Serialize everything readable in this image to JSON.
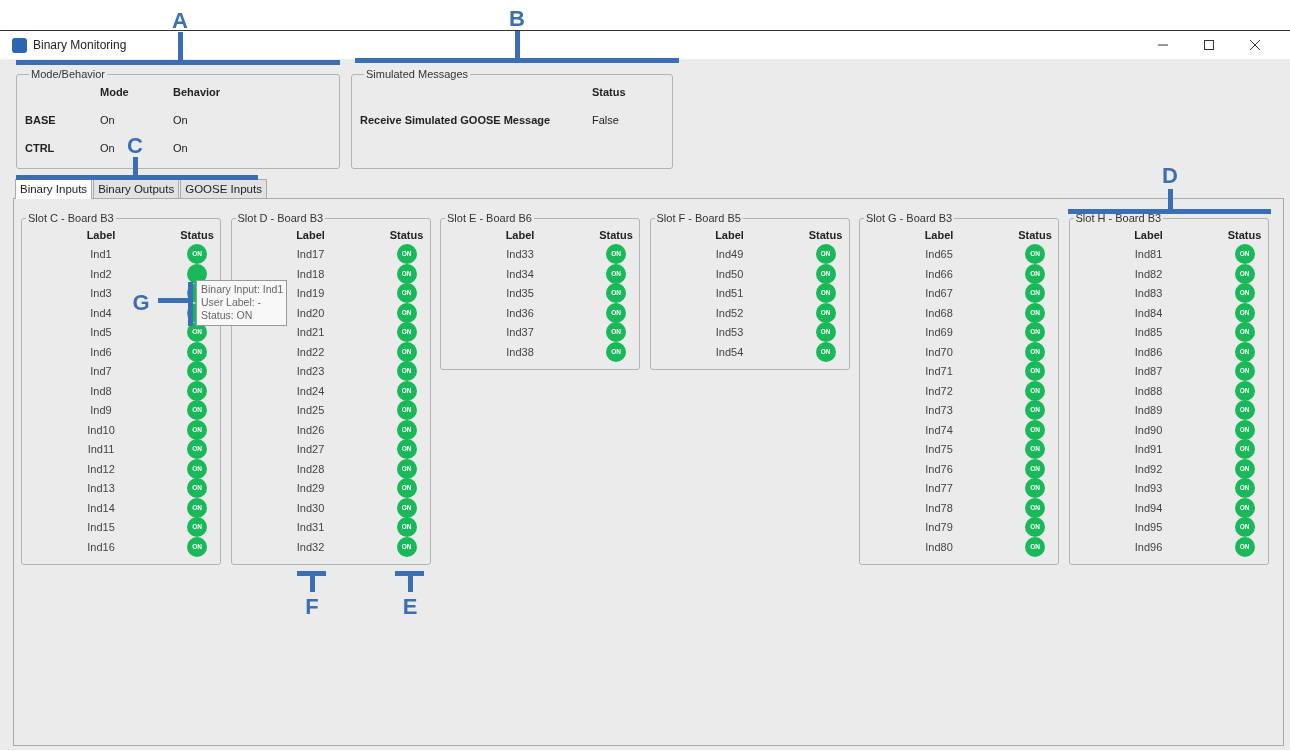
{
  "window": {
    "title": "Binary Monitoring"
  },
  "mode_behavior": {
    "title": "Mode/Behavior",
    "columns": [
      "Mode",
      "Behavior"
    ],
    "rows": [
      {
        "name": "BASE",
        "mode": "On",
        "behavior": "On"
      },
      {
        "name": "CTRL",
        "mode": "On",
        "behavior": "On"
      }
    ]
  },
  "simulated_messages": {
    "title": "Simulated Messages",
    "columns": [
      "Status"
    ],
    "rows": [
      {
        "name": "Receive Simulated GOOSE Message",
        "status": "False"
      }
    ]
  },
  "tabs": [
    {
      "label": "Binary Inputs",
      "selected": true
    },
    {
      "label": "Binary Outputs",
      "selected": false
    },
    {
      "label": "GOOSE Inputs",
      "selected": false
    }
  ],
  "slots": [
    {
      "title": "Slot C - Board B3",
      "columns": [
        "Label",
        "Status"
      ],
      "rows": [
        {
          "label": "Ind1",
          "status": "ON"
        },
        {
          "label": "Ind2"
        },
        {
          "label": "Ind3"
        },
        {
          "label": "Ind4"
        },
        {
          "label": "Ind5",
          "status": "ON"
        },
        {
          "label": "Ind6",
          "status": "ON"
        },
        {
          "label": "Ind7",
          "status": "ON"
        },
        {
          "label": "Ind8",
          "status": "ON"
        },
        {
          "label": "Ind9",
          "status": "ON"
        },
        {
          "label": "Ind10",
          "status": "ON"
        },
        {
          "label": "Ind11",
          "status": "ON"
        },
        {
          "label": "Ind12",
          "status": "ON"
        },
        {
          "label": "Ind13",
          "status": "ON"
        },
        {
          "label": "Ind14",
          "status": "ON"
        },
        {
          "label": "Ind15",
          "status": "ON"
        },
        {
          "label": "Ind16",
          "status": "ON"
        }
      ]
    },
    {
      "title": "Slot D - Board B3",
      "columns": [
        "Label",
        "Status"
      ],
      "rows": [
        {
          "label": "Ind17",
          "status": "ON"
        },
        {
          "label": "Ind18",
          "status": "ON"
        },
        {
          "label": "Ind19",
          "status": "ON"
        },
        {
          "label": "Ind20",
          "status": "ON"
        },
        {
          "label": "Ind21",
          "status": "ON"
        },
        {
          "label": "Ind22",
          "status": "ON"
        },
        {
          "label": "Ind23",
          "status": "ON"
        },
        {
          "label": "Ind24",
          "status": "ON"
        },
        {
          "label": "Ind25",
          "status": "ON"
        },
        {
          "label": "Ind26",
          "status": "ON"
        },
        {
          "label": "Ind27",
          "status": "ON"
        },
        {
          "label": "Ind28",
          "status": "ON"
        },
        {
          "label": "Ind29",
          "status": "ON"
        },
        {
          "label": "Ind30",
          "status": "ON"
        },
        {
          "label": "Ind31",
          "status": "ON"
        },
        {
          "label": "Ind32",
          "status": "ON"
        }
      ]
    },
    {
      "title": "Slot E - Board B6",
      "columns": [
        "Label",
        "Status"
      ],
      "rows": [
        {
          "label": "Ind33",
          "status": "ON"
        },
        {
          "label": "Ind34",
          "status": "ON"
        },
        {
          "label": "Ind35",
          "status": "ON"
        },
        {
          "label": "Ind36",
          "status": "ON"
        },
        {
          "label": "Ind37",
          "status": "ON"
        },
        {
          "label": "Ind38",
          "status": "ON"
        }
      ]
    },
    {
      "title": "Slot F - Board B5",
      "columns": [
        "Label",
        "Status"
      ],
      "rows": [
        {
          "label": "Ind49",
          "status": "ON"
        },
        {
          "label": "Ind50",
          "status": "ON"
        },
        {
          "label": "Ind51",
          "status": "ON"
        },
        {
          "label": "Ind52",
          "status": "ON"
        },
        {
          "label": "Ind53",
          "status": "ON"
        },
        {
          "label": "Ind54",
          "status": "ON"
        }
      ]
    },
    {
      "title": "Slot G - Board B3",
      "columns": [
        "Label",
        "Status"
      ],
      "rows": [
        {
          "label": "Ind65",
          "status": "ON"
        },
        {
          "label": "Ind66",
          "status": "ON"
        },
        {
          "label": "Ind67",
          "status": "ON"
        },
        {
          "label": "Ind68",
          "status": "ON"
        },
        {
          "label": "Ind69",
          "status": "ON"
        },
        {
          "label": "Ind70",
          "status": "ON"
        },
        {
          "label": "Ind71",
          "status": "ON"
        },
        {
          "label": "Ind72",
          "status": "ON"
        },
        {
          "label": "Ind73",
          "status": "ON"
        },
        {
          "label": "Ind74",
          "status": "ON"
        },
        {
          "label": "Ind75",
          "status": "ON"
        },
        {
          "label": "Ind76",
          "status": "ON"
        },
        {
          "label": "Ind77",
          "status": "ON"
        },
        {
          "label": "Ind78",
          "status": "ON"
        },
        {
          "label": "Ind79",
          "status": "ON"
        },
        {
          "label": "Ind80",
          "status": "ON"
        }
      ]
    },
    {
      "title": "Slot H - Board B3",
      "columns": [
        "Label",
        "Status"
      ],
      "rows": [
        {
          "label": "Ind81",
          "status": "ON"
        },
        {
          "label": "Ind82",
          "status": "ON"
        },
        {
          "label": "Ind83",
          "status": "ON"
        },
        {
          "label": "Ind84",
          "status": "ON"
        },
        {
          "label": "Ind85",
          "status": "ON"
        },
        {
          "label": "Ind86",
          "status": "ON"
        },
        {
          "label": "Ind87",
          "status": "ON"
        },
        {
          "label": "Ind88",
          "status": "ON"
        },
        {
          "label": "Ind89",
          "status": "ON"
        },
        {
          "label": "Ind90",
          "status": "ON"
        },
        {
          "label": "Ind91",
          "status": "ON"
        },
        {
          "label": "Ind92",
          "status": "ON"
        },
        {
          "label": "Ind93",
          "status": "ON"
        },
        {
          "label": "Ind94",
          "status": "ON"
        },
        {
          "label": "Ind95",
          "status": "ON"
        },
        {
          "label": "Ind96",
          "status": "ON"
        }
      ]
    }
  ],
  "tooltip": {
    "lines": [
      "Binary Input: Ind1",
      "User Label: -",
      "Status: ON"
    ]
  },
  "callouts": [
    {
      "letter": "A"
    },
    {
      "letter": "B"
    },
    {
      "letter": "C"
    },
    {
      "letter": "D"
    },
    {
      "letter": "E"
    },
    {
      "letter": "F"
    },
    {
      "letter": "G"
    }
  ]
}
